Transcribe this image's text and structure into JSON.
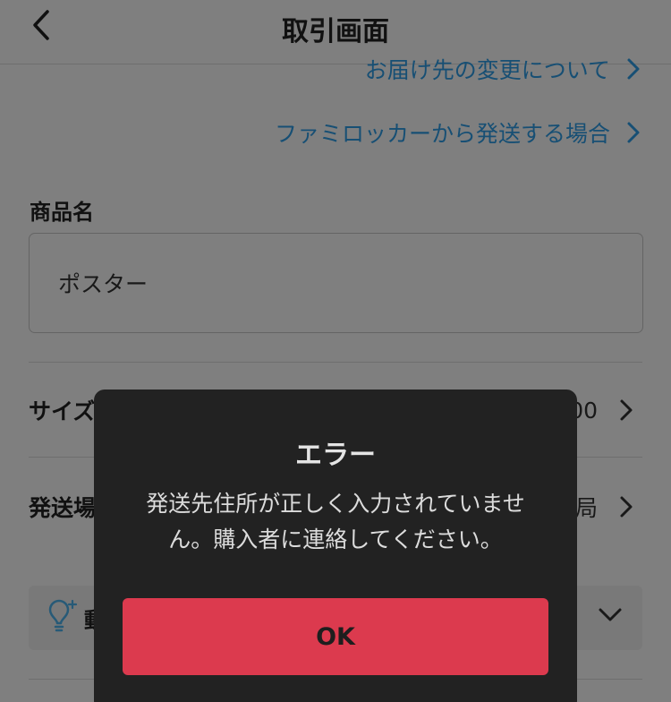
{
  "header": {
    "title": "取引画面"
  },
  "links": [
    {
      "label": "お届け先の変更について"
    },
    {
      "label": "ファミロッカーから発送する場合"
    }
  ],
  "product": {
    "label": "商品名",
    "value": "ポスター"
  },
  "rows": {
    "size": {
      "label": "サイズ",
      "value": "00"
    },
    "method": {
      "label": "発送場所",
      "value": "局"
    }
  },
  "tip": {
    "label": "動"
  },
  "dialog": {
    "title": "エラー",
    "message": "発送先住所が正しく入力されていません。購入者に連絡してください。",
    "ok_label": "OK"
  },
  "colors": {
    "accent_link": "#2f9ee8",
    "ok_button": "#dc3a4e",
    "dialog_bg": "#222222"
  },
  "icons": {
    "back": "chevron-left-icon",
    "link": "chevron-right-icon",
    "tip": "lightbulb-icon",
    "expand": "chevron-down-icon"
  }
}
